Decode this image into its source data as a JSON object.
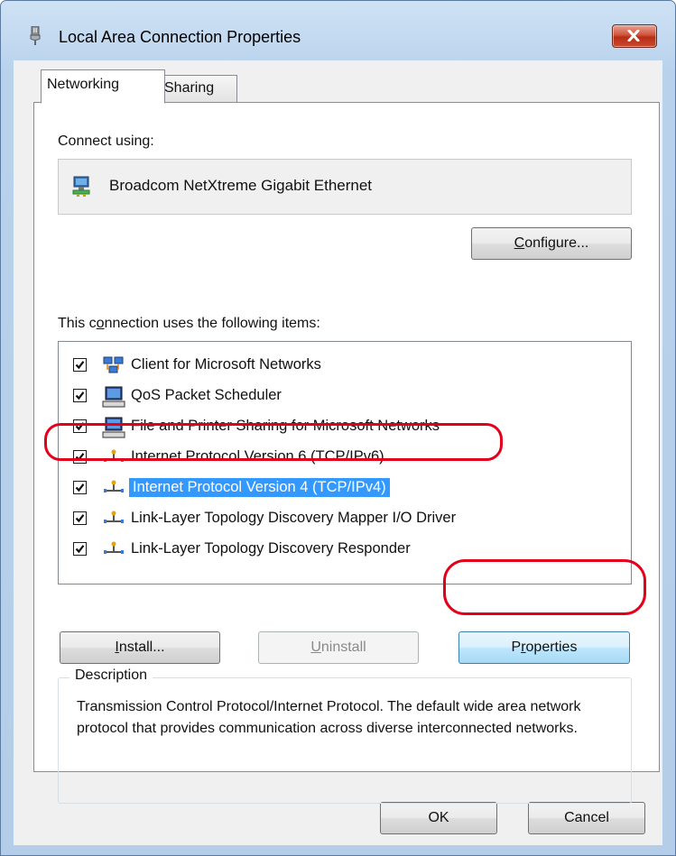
{
  "window": {
    "title": "Local Area Connection Properties",
    "close_glyph": "×"
  },
  "tabs": [
    {
      "label": "Networking",
      "active": true
    },
    {
      "label": "Sharing",
      "active": false
    }
  ],
  "connect_using": {
    "label": "Connect using:",
    "adapter_name": "Broadcom NetXtreme Gigabit Ethernet",
    "adapter_icon": "network-adapter-icon"
  },
  "configure_button": {
    "pre": "",
    "mnemonic": "C",
    "post": "onfigure..."
  },
  "items_label": {
    "pre": "This c",
    "mnemonic": "o",
    "post": "nnection uses the following items:"
  },
  "items": [
    {
      "label": "Client for Microsoft Networks",
      "checked": true,
      "icon": "client-network-icon"
    },
    {
      "label": "QoS Packet Scheduler",
      "checked": true,
      "icon": "service-computer-icon"
    },
    {
      "label": "File and Printer Sharing for Microsoft Networks",
      "checked": true,
      "icon": "service-computer-icon"
    },
    {
      "label": "Internet Protocol Version 6 (TCP/IPv6)",
      "checked": true,
      "icon": "protocol-icon"
    },
    {
      "label": "Internet Protocol Version 4 (TCP/IPv4)",
      "checked": true,
      "icon": "protocol-icon",
      "selected": true
    },
    {
      "label": "Link-Layer Topology Discovery Mapper I/O Driver",
      "checked": true,
      "icon": "protocol-icon"
    },
    {
      "label": "Link-Layer Topology Discovery Responder",
      "checked": true,
      "icon": "protocol-icon"
    }
  ],
  "install_button": {
    "pre": "",
    "mnemonic": "I",
    "post": "nstall..."
  },
  "uninstall_button": {
    "pre": "",
    "mnemonic": "U",
    "post": "ninstall",
    "disabled": true
  },
  "properties_button": {
    "pre": "P",
    "mnemonic": "r",
    "post": "operties"
  },
  "description": {
    "legend": "Description",
    "text": "Transmission Control Protocol/Internet Protocol. The default wide area network protocol that provides communication across diverse interconnected networks."
  },
  "footer": {
    "ok_label": "OK",
    "cancel_label": "Cancel"
  },
  "colors": {
    "selection": "#3399ff",
    "highlight": "#e3001b"
  }
}
